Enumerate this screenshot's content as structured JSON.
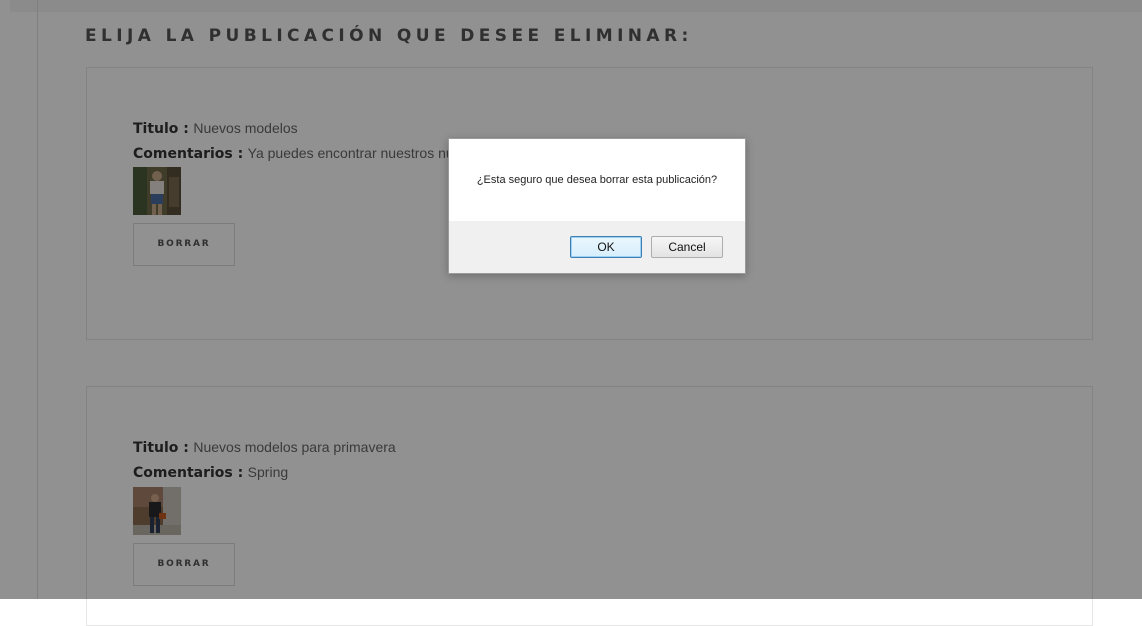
{
  "page": {
    "heading": "ELIJA LA PUBLICACIÓN QUE DESEE ELIMINAR:"
  },
  "posts": [
    {
      "title_label": "Titulo :",
      "title_value": "Nuevos modelos",
      "comments_label": "Comentarios :",
      "comments_value": "Ya puedes encontrar nuestros nuev",
      "delete_label": "BORRAR"
    },
    {
      "title_label": "Titulo :",
      "title_value": "Nuevos modelos para primavera",
      "comments_label": "Comentarios :",
      "comments_value": "Spring",
      "delete_label": "BORRAR"
    }
  ],
  "dialog": {
    "message": "¿Esta seguro que desea borrar esta publicación?",
    "ok_label": "OK",
    "cancel_label": "Cancel"
  },
  "colors": {
    "overlay": "#000000",
    "ok_border": "#3c7fb1"
  }
}
